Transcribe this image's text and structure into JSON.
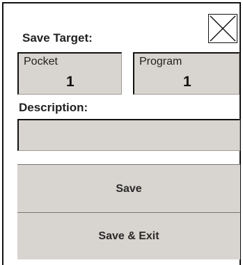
{
  "dialog": {
    "close_icon": "close-icon",
    "save_target_label": "Save Target:",
    "pocket": {
      "caption": "Pocket",
      "value": "1"
    },
    "program": {
      "caption": "Program",
      "value": "1"
    },
    "description_label": "Description:",
    "description_value": "",
    "save_label": "Save",
    "save_exit_label": "Save & Exit"
  },
  "colors": {
    "field_background": "#d8d4cf",
    "border": "#111111",
    "background": "#ffffff"
  }
}
